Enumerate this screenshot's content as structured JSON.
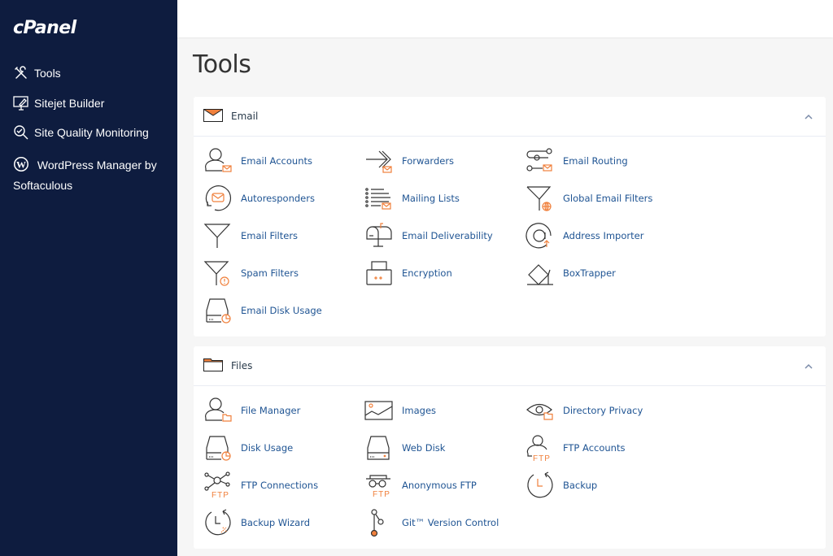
{
  "sidebar": {
    "logo": "cPanel",
    "items": [
      {
        "label": "Tools",
        "icon": "tools-icon"
      },
      {
        "label": "Sitejet Builder",
        "icon": "sitejet-icon"
      },
      {
        "label": "Site Quality Monitoring",
        "icon": "site-quality-icon"
      },
      {
        "label": "WordPress Manager by Softaculous",
        "icon": "wordpress-icon"
      }
    ]
  },
  "page": {
    "title": "Tools"
  },
  "colors": {
    "sidebar_bg": "#0e1c3f",
    "accent_orange": "#f0803c",
    "link_blue": "#1f5493"
  },
  "sections": [
    {
      "title": "Email",
      "icon": "envelope-icon",
      "collapse_icon": "chevron-up-icon",
      "tools": [
        {
          "label": "Email Accounts",
          "icon": "email-accounts-icon"
        },
        {
          "label": "Forwarders",
          "icon": "forwarders-icon"
        },
        {
          "label": "Email Routing",
          "icon": "email-routing-icon"
        },
        {
          "label": "Autoresponders",
          "icon": "autoresponders-icon"
        },
        {
          "label": "Mailing Lists",
          "icon": "mailing-lists-icon"
        },
        {
          "label": "Global Email Filters",
          "icon": "global-email-filters-icon"
        },
        {
          "label": "Email Filters",
          "icon": "email-filters-icon"
        },
        {
          "label": "Email Deliverability",
          "icon": "email-deliverability-icon"
        },
        {
          "label": "Address Importer",
          "icon": "address-importer-icon"
        },
        {
          "label": "Spam Filters",
          "icon": "spam-filters-icon"
        },
        {
          "label": "Encryption",
          "icon": "encryption-icon"
        },
        {
          "label": "BoxTrapper",
          "icon": "boxtrapper-icon"
        },
        {
          "label": "Email Disk Usage",
          "icon": "email-disk-usage-icon"
        }
      ]
    },
    {
      "title": "Files",
      "icon": "folder-icon",
      "collapse_icon": "chevron-up-icon",
      "tools": [
        {
          "label": "File Manager",
          "icon": "file-manager-icon"
        },
        {
          "label": "Images",
          "icon": "images-icon"
        },
        {
          "label": "Directory Privacy",
          "icon": "directory-privacy-icon"
        },
        {
          "label": "Disk Usage",
          "icon": "disk-usage-icon"
        },
        {
          "label": "Web Disk",
          "icon": "web-disk-icon"
        },
        {
          "label": "FTP Accounts",
          "icon": "ftp-accounts-icon"
        },
        {
          "label": "FTP Connections",
          "icon": "ftp-connections-icon"
        },
        {
          "label": "Anonymous FTP",
          "icon": "anonymous-ftp-icon"
        },
        {
          "label": "Backup",
          "icon": "backup-icon"
        },
        {
          "label": "Backup Wizard",
          "icon": "backup-wizard-icon"
        },
        {
          "label": "Git™ Version Control",
          "icon": "git-icon"
        }
      ]
    }
  ]
}
